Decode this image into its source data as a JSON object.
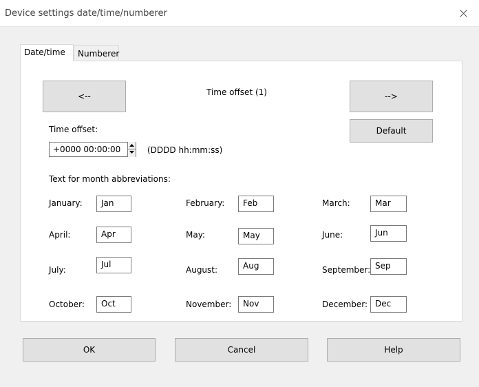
{
  "window": {
    "title": "Device settings date/time/numberer"
  },
  "tabs": [
    {
      "label": "Date/time",
      "active": true
    },
    {
      "label": "Numberer",
      "active": false
    }
  ],
  "nav": {
    "prev_label": "<--",
    "next_label": "-->",
    "caption": "Time offset (1)",
    "default_label": "Default"
  },
  "offset": {
    "label": "Time offset:",
    "value": "+0000 00:00:00",
    "format_hint": "(DDDD hh:mm:ss)"
  },
  "months": {
    "heading": "Text for month abbreviations:",
    "items": [
      {
        "label": "January:",
        "value": "Jan"
      },
      {
        "label": "February:",
        "value": "Feb"
      },
      {
        "label": "March:",
        "value": "Mar"
      },
      {
        "label": "April:",
        "value": "Apr"
      },
      {
        "label": "May:",
        "value": "May"
      },
      {
        "label": "June:",
        "value": "Jun"
      },
      {
        "label": "July:",
        "value": "Jul"
      },
      {
        "label": "August:",
        "value": "Aug"
      },
      {
        "label": "September:",
        "value": "Sep"
      },
      {
        "label": "October:",
        "value": "Oct"
      },
      {
        "label": "November:",
        "value": "Nov"
      },
      {
        "label": "December:",
        "value": "Dec"
      }
    ]
  },
  "footer": {
    "ok_label": "OK",
    "cancel_label": "Cancel",
    "help_label": "Help"
  }
}
